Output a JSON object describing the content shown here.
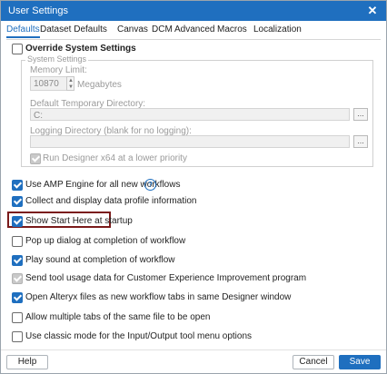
{
  "window": {
    "title": "User Settings"
  },
  "tabs": [
    {
      "label": "Defaults",
      "active": true
    },
    {
      "label": "Dataset Defaults",
      "active": false
    },
    {
      "label": "Canvas",
      "active": false
    },
    {
      "label": "DCM",
      "active": false
    },
    {
      "label": "Advanced",
      "active": false
    },
    {
      "label": "Macros",
      "active": false
    },
    {
      "label": "Localization",
      "active": false
    }
  ],
  "override": {
    "label": "Override System Settings",
    "checked": false
  },
  "system_settings": {
    "legend": "System Settings",
    "memory_limit_label": "Memory Limit:",
    "memory_limit_value": "10870",
    "memory_unit": "Megabytes",
    "temp_dir_label": "Default Temporary Directory:",
    "temp_dir_value": "C:",
    "logging_label": "Logging Directory (blank for no logging):",
    "logging_value": "",
    "browse_label": "...",
    "lower_priority_label": "Run Designer x64 at a lower priority"
  },
  "options": [
    {
      "label": "Use AMP Engine for all new workflows",
      "checked": true
    },
    {
      "label": "Collect and display data profile information",
      "checked": true
    },
    {
      "label": "Show Start Here at startup",
      "checked": true
    },
    {
      "label": "Pop up dialog at completion of workflow",
      "checked": false
    },
    {
      "label": "Play sound at completion of workflow",
      "checked": true
    },
    {
      "label": "Send tool usage data for Customer Experience Improvement program",
      "checked": true,
      "disabled": true
    },
    {
      "label": "Open Alteryx files as new workflow tabs in same Designer window",
      "checked": true
    },
    {
      "label": "Allow multiple tabs of the same file to be open",
      "checked": false
    },
    {
      "label": "Use classic mode for the Input/Output tool menu options",
      "checked": false
    }
  ],
  "help_icon": "question-mark",
  "footer": {
    "help": "Help",
    "cancel": "Cancel",
    "save": "Save"
  },
  "colors": {
    "accent": "#1f6fbf",
    "highlight_border": "#7a1a1a"
  }
}
